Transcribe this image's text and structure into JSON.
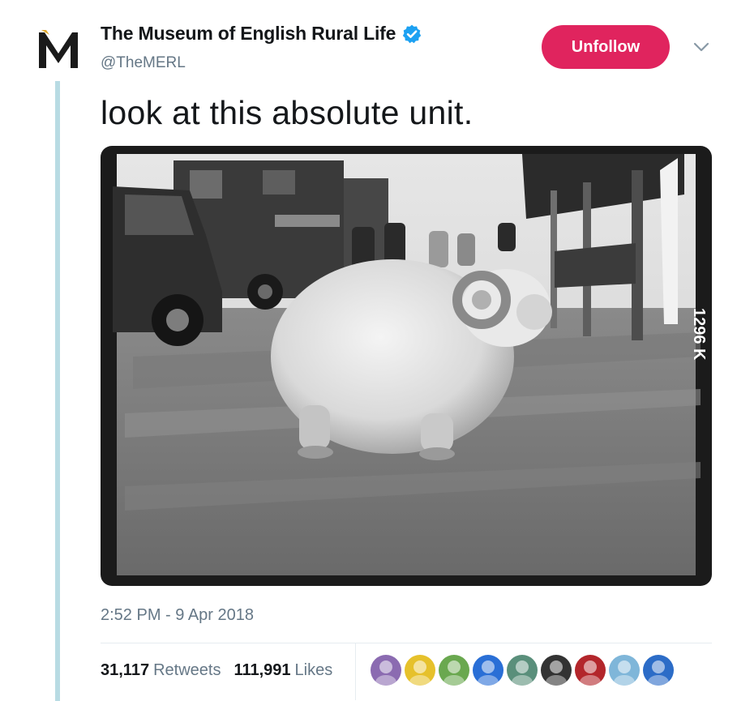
{
  "tweet": {
    "display_name": "The Museum of English Rural Life",
    "handle": "@TheMERL",
    "text": "look at this absolute unit.",
    "timestamp": "2:52 PM - 9 Apr 2018",
    "verified": true,
    "avatar_icon": "merl-logo-icon"
  },
  "actions": {
    "unfollow_label": "Unfollow",
    "menu_icon": "chevron-down-icon"
  },
  "media": {
    "type": "photo",
    "subject": "ram sheep",
    "style": "black-and-white",
    "negative_mark": "1296 K"
  },
  "stats": {
    "retweets_count": "31,117",
    "retweets_label": "Retweets",
    "likes_count": "111,991",
    "likes_label": "Likes"
  },
  "likers": [
    {
      "icon": "purple-girl-avatar",
      "color": "#8b6bb1"
    },
    {
      "icon": "yellow-character-avatar",
      "color": "#e6c12b"
    },
    {
      "icon": "cartoon-man-avatar",
      "color": "#6aa84f"
    },
    {
      "icon": "blue-hair-avatar",
      "color": "#2a6fd6"
    },
    {
      "icon": "anime-character-avatar",
      "color": "#5a8f7b"
    },
    {
      "icon": "dark-portrait-avatar",
      "color": "#333333"
    },
    {
      "icon": "red-dark-avatar",
      "color": "#b3262b"
    },
    {
      "icon": "whale-avatar",
      "color": "#7fb6d9"
    },
    {
      "icon": "chips-ahoy-avatar",
      "color": "#2c6cc7"
    }
  ],
  "colors": {
    "accent_unfollow": "#e0245e",
    "verified_blue": "#1da1f2",
    "thread_line": "#b8dbe3",
    "muted_text": "#657786"
  }
}
